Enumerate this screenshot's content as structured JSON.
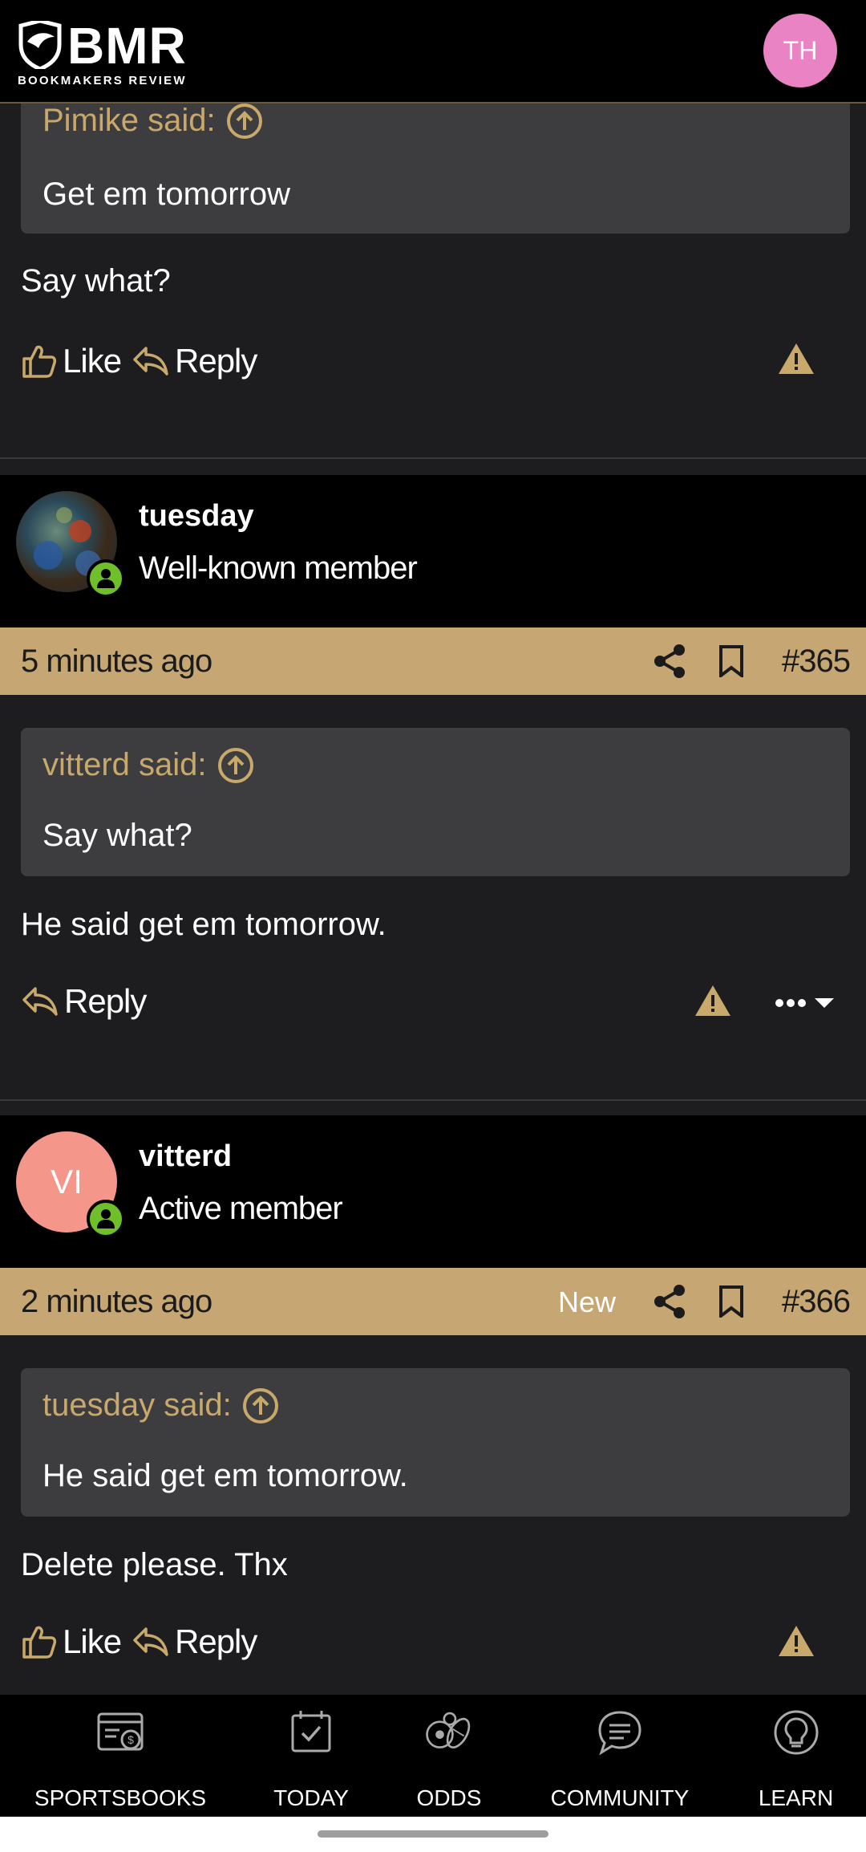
{
  "header": {
    "logo_word": "BMR",
    "logo_tagline": "BOOKMAKERS REVIEW",
    "user_initials": "TH",
    "avatar_color": "#e983c3"
  },
  "post_prev": {
    "quote_author": "Pimike said:",
    "quote_text": "Get em tomorrow",
    "message": "Say what?",
    "like_label": "Like",
    "reply_label": "Reply"
  },
  "post_365": {
    "username": "tuesday",
    "role": "Well-known member",
    "time": "5 minutes ago",
    "number": "#365",
    "quote_author": "vitterd said:",
    "quote_text": "Say what?",
    "message": "He said get em tomorrow.",
    "reply_label": "Reply"
  },
  "post_366": {
    "username": "vitterd",
    "role": "Active member",
    "avatar_initials": "VI",
    "avatar_color": "#f4978a",
    "time": "2 minutes ago",
    "new_badge": "New",
    "number": "#366",
    "quote_author": "tuesday said:",
    "quote_text": "He said get em tomorrow.",
    "message": "Delete please. Thx",
    "like_label": "Like",
    "reply_label": "Reply"
  },
  "bottom_nav": {
    "items": [
      {
        "label": "SPORTSBOOKS",
        "icon": "sportsbooks-icon"
      },
      {
        "label": "TODAY",
        "icon": "calendar-check-icon"
      },
      {
        "label": "ODDS",
        "icon": "balls-icon"
      },
      {
        "label": "COMMUNITY",
        "icon": "chat-icon"
      },
      {
        "label": "LEARN",
        "icon": "lightbulb-icon"
      }
    ]
  },
  "colors": {
    "accent_gold": "#c6a773",
    "online_green": "#6fbf2a",
    "warning_gold": "#c8a96b"
  }
}
